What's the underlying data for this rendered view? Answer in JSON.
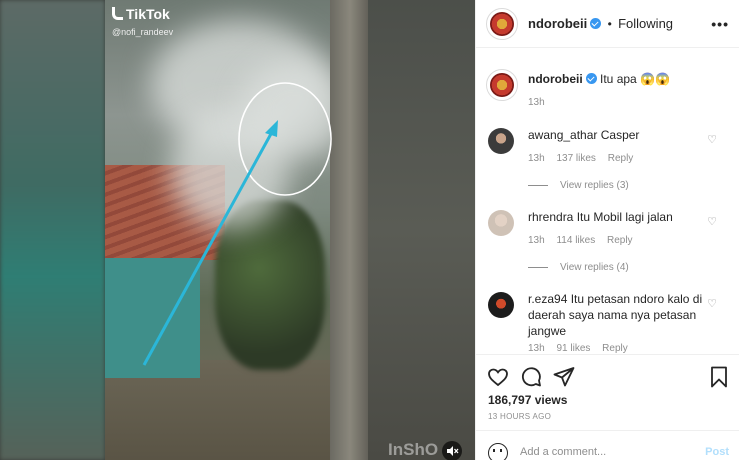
{
  "media": {
    "watermark_app": "TikTok",
    "watermark_user": "@nofi_randeev",
    "watermark_editor": "InShO",
    "mute_icon": "speaker-muted-icon",
    "annotation_color": "#2bb6d8"
  },
  "header": {
    "username": "ndorobeii",
    "separator": "•",
    "follow_status": "Following",
    "more_icon": "ellipsis-icon"
  },
  "caption": {
    "username": "ndorobeii",
    "text": "Itu apa 😱😱",
    "time": "13h"
  },
  "comments": [
    {
      "username": "awang_athar",
      "text": "Casper",
      "time": "13h",
      "likes": "137 likes",
      "reply": "Reply",
      "view_replies": "View replies (3)"
    },
    {
      "username": "rhrendra",
      "text": "Itu Mobil lagi jalan",
      "time": "13h",
      "likes": "114 likes",
      "reply": "Reply",
      "view_replies": "View replies (4)"
    },
    {
      "username": "r.eza94",
      "text": "Itu petasan ndoro kalo di daerah saya nama nya petasan jangwe",
      "time": "13h",
      "likes": "91 likes",
      "reply": "Reply"
    }
  ],
  "stats": {
    "views": "186,797 views",
    "posted_ago": "13 HOURS AGO"
  },
  "add_comment": {
    "placeholder": "Add a comment...",
    "post_label": "Post"
  },
  "colors": {
    "verified": "#3897f0",
    "secondary_text": "#8e8e8e",
    "post_disabled": "#b2dffc"
  }
}
